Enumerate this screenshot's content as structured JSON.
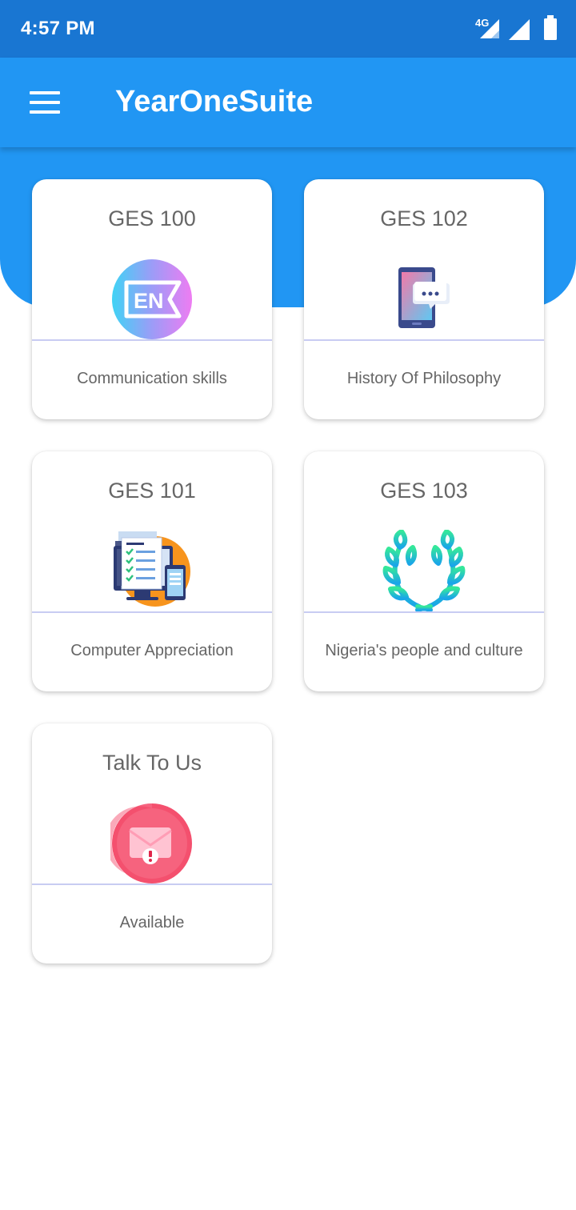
{
  "status_bar": {
    "time": "4:57 PM",
    "network": "4G",
    "icons": [
      "signal-4g-icon",
      "signal-icon",
      "battery-icon"
    ]
  },
  "app_bar": {
    "title": "YearOneSuite",
    "menu_icon": "hamburger-menu-icon"
  },
  "colors": {
    "status_bar": "#1976d2",
    "primary": "#2196f3",
    "divider": "#c8ccf2"
  },
  "cards": [
    {
      "title": "GES 100",
      "subtitle": "Communication skills",
      "icon": "english-language-icon"
    },
    {
      "title": "GES 102",
      "subtitle": "History Of Philosophy",
      "icon": "phone-chat-icon"
    },
    {
      "title": "GES 101",
      "subtitle": "Computer Appreciation",
      "icon": "computer-checklist-icon"
    },
    {
      "title": "GES 103",
      "subtitle": "Nigeria's people and culture",
      "icon": "laurel-wreath-icon"
    },
    {
      "title": "Talk To Us",
      "subtitle": "Available",
      "icon": "mail-alert-icon"
    }
  ]
}
